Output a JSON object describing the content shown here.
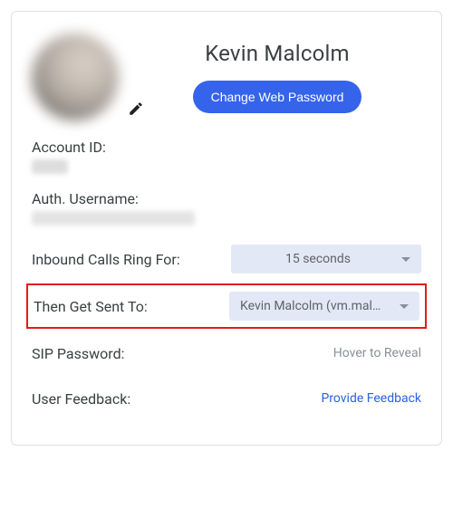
{
  "user": {
    "name": "Kevin Malcolm"
  },
  "buttons": {
    "change_password": "Change Web Password"
  },
  "labels": {
    "account_id": "Account ID:",
    "auth_username": "Auth. Username:",
    "inbound_ring": "Inbound Calls Ring For:",
    "then_sent_to": "Then Get Sent To:",
    "sip_password": "SIP Password:",
    "user_feedback": "User Feedback:"
  },
  "values": {
    "inbound_ring": "15 seconds",
    "then_sent_to": "Kevin Malcolm (vm.malcol…",
    "sip_password": "Hover to Reveal",
    "feedback_link": "Provide Feedback"
  }
}
